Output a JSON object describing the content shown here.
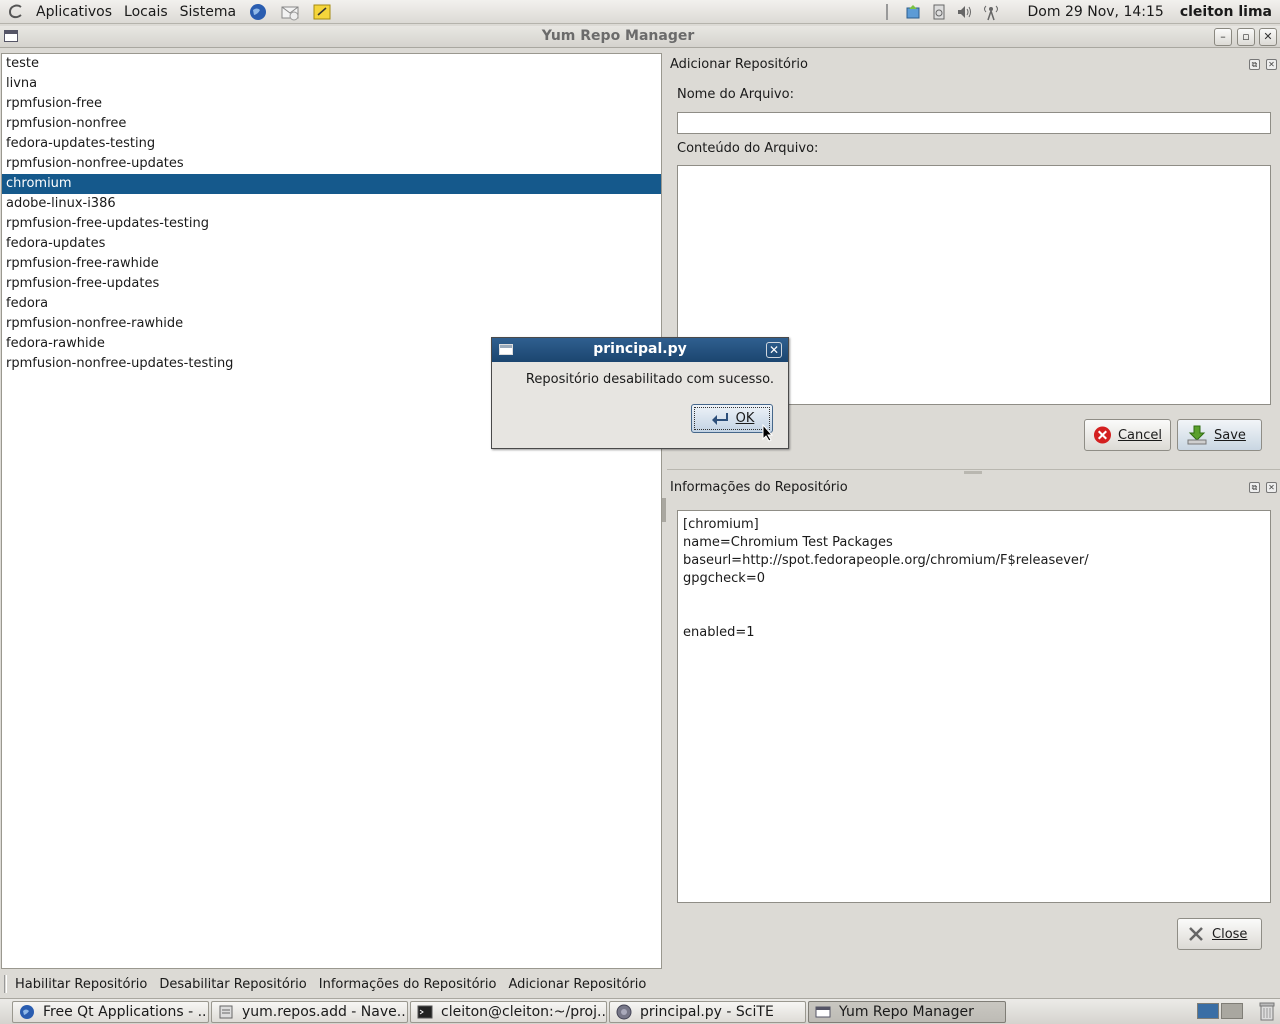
{
  "top_panel": {
    "menus": [
      "Aplicativos",
      "Locais",
      "Sistema"
    ],
    "clock": "Dom 29 Nov, 14:15",
    "user": "cleiton lima"
  },
  "window": {
    "title": "Yum Repo Manager"
  },
  "repo_list": {
    "items": [
      "teste",
      "livna",
      "rpmfusion-free",
      "rpmfusion-nonfree",
      "fedora-updates-testing",
      "rpmfusion-nonfree-updates",
      "chromium",
      "adobe-linux-i386",
      "rpmfusion-free-updates-testing",
      "fedora-updates",
      "rpmfusion-free-rawhide",
      "rpmfusion-free-updates",
      "fedora",
      "rpmfusion-nonfree-rawhide",
      "fedora-rawhide",
      "rpmfusion-nonfree-updates-testing"
    ],
    "selected_index": 6
  },
  "add_panel": {
    "title": "Adicionar Repositório",
    "filename_label": "Nome do Arquivo:",
    "filename_value": "",
    "content_label": "Conteúdo do Arquivo:",
    "content_value": "",
    "cancel_label": "Cancel",
    "save_label": "Save"
  },
  "info_panel": {
    "title": "Informações do Repositório",
    "lines": [
      "[chromium]",
      "name=Chromium Test Packages",
      "baseurl=http://spot.fedorapeople.org/chromium/F$releasever/",
      "gpgcheck=0",
      "",
      "",
      "enabled=1"
    ],
    "close_label": "Close"
  },
  "toolbar": {
    "actions": [
      "Habilitar Repositório",
      "Desabilitar Repositório",
      "Informações do Repositório",
      "Adicionar Repositório"
    ]
  },
  "taskbar": {
    "tasks": [
      "Free Qt Applications - ...",
      "yum.repos.add - Nave...",
      "cleiton@cleiton:~/proj...",
      "principal.py - SciTE",
      "Yum Repo Manager"
    ],
    "active_index": 4
  },
  "dialog": {
    "title": "principal.py",
    "message": "Repositório desabilitado com sucesso.",
    "ok_label": "OK"
  },
  "colors": {
    "selection": "#15598c",
    "dialog_title": "#1b456f"
  }
}
